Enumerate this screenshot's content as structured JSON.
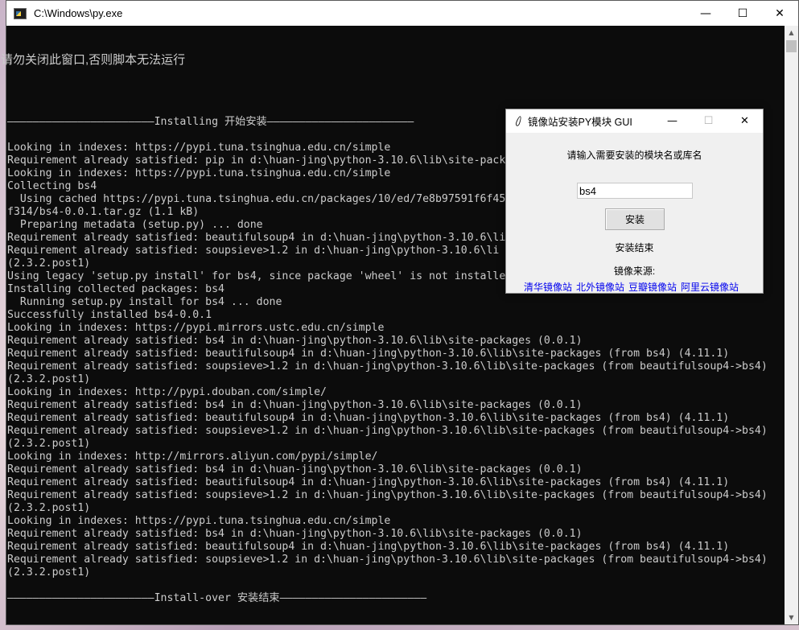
{
  "console": {
    "title": "C:\\Windows\\py.exe",
    "controls": {
      "minimize": "—",
      "maximize": "☐",
      "close": "✕"
    },
    "warning": "请勿关闭此窗口,否则脚本无法运行",
    "lines": [
      "",
      "",
      "",
      "",
      "",
      "———————————————————————Installing 开始安装———————————————————————",
      "",
      "Looking in indexes: https://pypi.tuna.tsinghua.edu.cn/simple",
      "Requirement already satisfied: pip in d:\\huan-jing\\python-3.10.6\\lib\\site-pack",
      "Looking in indexes: https://pypi.tuna.tsinghua.edu.cn/simple",
      "Collecting bs4",
      "  Using cached https://pypi.tuna.tsinghua.edu.cn/packages/10/ed/7e8b97591f6f45",
      "f314/bs4-0.0.1.tar.gz (1.1 kB)",
      "  Preparing metadata (setup.py) ... done",
      "Requirement already satisfied: beautifulsoup4 in d:\\huan-jing\\python-3.10.6\\li",
      "Requirement already satisfied: soupsieve>1.2 in d:\\huan-jing\\python-3.10.6\\li",
      "(2.3.2.post1)",
      "Using legacy 'setup.py install' for bs4, since package 'wheel' is not installe",
      "Installing collected packages: bs4",
      "  Running setup.py install for bs4 ... done",
      "Successfully installed bs4-0.0.1",
      "Looking in indexes: https://pypi.mirrors.ustc.edu.cn/simple",
      "Requirement already satisfied: bs4 in d:\\huan-jing\\python-3.10.6\\lib\\site-packages (0.0.1)",
      "Requirement already satisfied: beautifulsoup4 in d:\\huan-jing\\python-3.10.6\\lib\\site-packages (from bs4) (4.11.1)",
      "Requirement already satisfied: soupsieve>1.2 in d:\\huan-jing\\python-3.10.6\\lib\\site-packages (from beautifulsoup4->bs4)",
      "(2.3.2.post1)",
      "Looking in indexes: http://pypi.douban.com/simple/",
      "Requirement already satisfied: bs4 in d:\\huan-jing\\python-3.10.6\\lib\\site-packages (0.0.1)",
      "Requirement already satisfied: beautifulsoup4 in d:\\huan-jing\\python-3.10.6\\lib\\site-packages (from bs4) (4.11.1)",
      "Requirement already satisfied: soupsieve>1.2 in d:\\huan-jing\\python-3.10.6\\lib\\site-packages (from beautifulsoup4->bs4)",
      "(2.3.2.post1)",
      "Looking in indexes: http://mirrors.aliyun.com/pypi/simple/",
      "Requirement already satisfied: bs4 in d:\\huan-jing\\python-3.10.6\\lib\\site-packages (0.0.1)",
      "Requirement already satisfied: beautifulsoup4 in d:\\huan-jing\\python-3.10.6\\lib\\site-packages (from bs4) (4.11.1)",
      "Requirement already satisfied: soupsieve>1.2 in d:\\huan-jing\\python-3.10.6\\lib\\site-packages (from beautifulsoup4->bs4)",
      "(2.3.2.post1)",
      "Looking in indexes: https://pypi.tuna.tsinghua.edu.cn/simple",
      "Requirement already satisfied: bs4 in d:\\huan-jing\\python-3.10.6\\lib\\site-packages (0.0.1)",
      "Requirement already satisfied: beautifulsoup4 in d:\\huan-jing\\python-3.10.6\\lib\\site-packages (from bs4) (4.11.1)",
      "Requirement already satisfied: soupsieve>1.2 in d:\\huan-jing\\python-3.10.6\\lib\\site-packages (from beautifulsoup4->bs4)",
      "(2.3.2.post1)",
      "",
      "———————————————————————Install-over 安装结束———————————————————————"
    ]
  },
  "gui": {
    "title": "镜像站安装PY模块 GUI",
    "controls": {
      "minimize": "—",
      "maximize": "☐",
      "close": "✕"
    },
    "prompt": "请输入需要安装的模块名或库名",
    "input_value": "bs4",
    "install_button": "安装",
    "status": "安装结束",
    "mirror_label": "镜像来源:",
    "mirrors": [
      "清华镜像站",
      "北外镜像站",
      "豆瓣镜像站",
      "阿里云镜像站"
    ]
  }
}
